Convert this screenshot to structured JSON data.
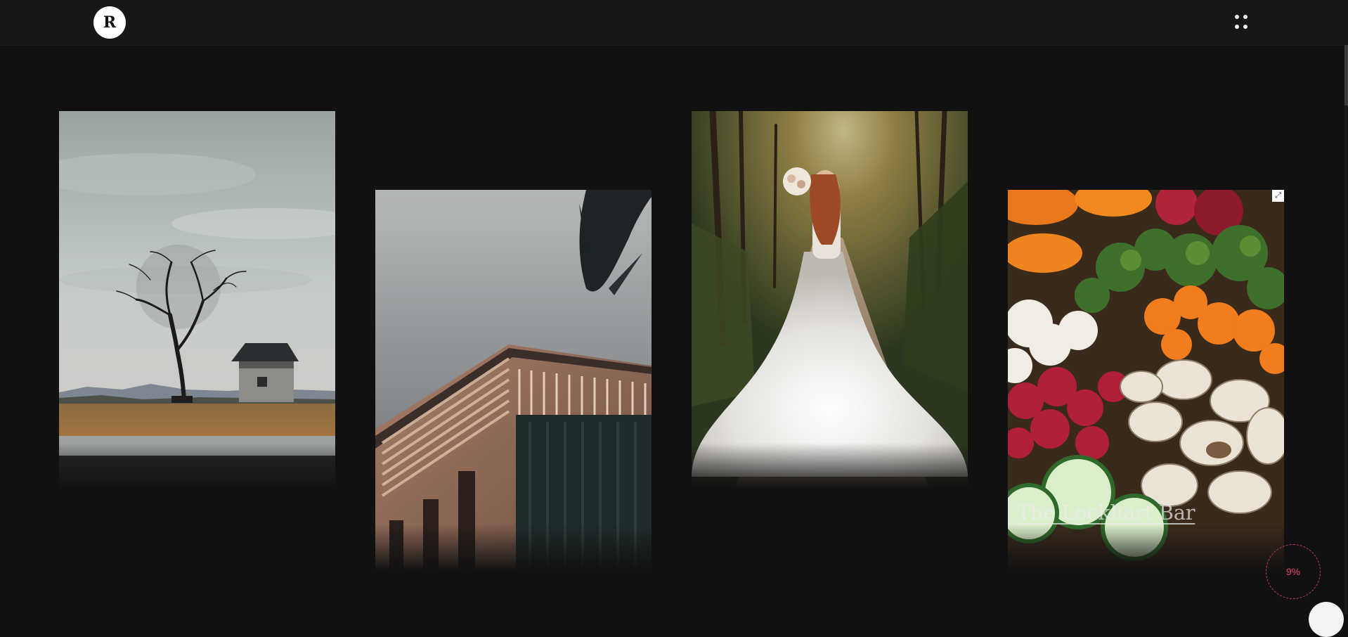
{
  "header": {
    "logo_letter": "R",
    "menu_icon": "four-dots-grid-icon"
  },
  "gallery": {
    "items": [
      {
        "image": "landscape with bare tree and stone hut",
        "caption": ""
      },
      {
        "image": "modern building corner with palm leaf",
        "caption": ""
      },
      {
        "image": "bride in white gown on forest path",
        "caption": ""
      },
      {
        "image": "fresh vegetables and mushrooms",
        "caption": "The Lockhart Bar"
      }
    ]
  },
  "scroll_progress": {
    "label": "9%",
    "value": 0.09
  },
  "colors": {
    "background": "#111111",
    "accent": "#e0456c"
  }
}
